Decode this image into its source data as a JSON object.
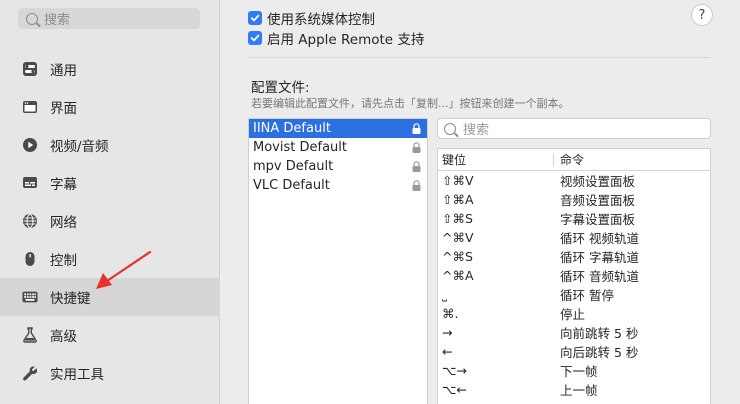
{
  "sidebar": {
    "search_placeholder": "搜索",
    "items": [
      {
        "label": "通用",
        "icon": "toggle-icon"
      },
      {
        "label": "界面",
        "icon": "window-icon"
      },
      {
        "label": "视频/音频",
        "icon": "play-icon"
      },
      {
        "label": "字幕",
        "icon": "subtitle-icon"
      },
      {
        "label": "网络",
        "icon": "globe-icon"
      },
      {
        "label": "控制",
        "icon": "mouse-icon"
      },
      {
        "label": "快捷键",
        "icon": "keyboard-icon"
      },
      {
        "label": "高级",
        "icon": "flask-icon"
      },
      {
        "label": "实用工具",
        "icon": "wrench-icon"
      }
    ],
    "active_index": 6
  },
  "options": {
    "system_media": "使用系统媒体控制",
    "apple_remote": "启用 Apple Remote 支持"
  },
  "help_label": "?",
  "config": {
    "title": "配置文件:",
    "hint": "若要编辑此配置文件，请先点击「复制...」按钮来创建一个副本。",
    "files": [
      "IINA Default",
      "Movist Default",
      "mpv Default",
      "VLC Default"
    ],
    "selected_index": 0
  },
  "keybind_search_placeholder": "搜索",
  "table": {
    "headers": {
      "key": "键位",
      "command": "命令"
    },
    "rows": [
      {
        "key": "⇧⌘V",
        "command": "视频设置面板"
      },
      {
        "key": "⇧⌘A",
        "command": "音频设置面板"
      },
      {
        "key": "⇧⌘S",
        "command": "字幕设置面板"
      },
      {
        "key": "^⌘V",
        "command": "循环 视频轨道"
      },
      {
        "key": "^⌘S",
        "command": "循环 字幕轨道"
      },
      {
        "key": "^⌘A",
        "command": "循环 音频轨道"
      },
      {
        "key": "˽",
        "command": "循环 暂停"
      },
      {
        "key": "⌘.",
        "command": "停止"
      },
      {
        "key": "→",
        "command": "向前跳转 5 秒"
      },
      {
        "key": "←",
        "command": "向后跳转 5 秒"
      },
      {
        "key": "⌥→",
        "command": "下一帧"
      },
      {
        "key": "⌥←",
        "command": "上一帧"
      }
    ]
  },
  "colors": {
    "accent": "#2f7cf6",
    "annotation_arrow": "#e8322b"
  }
}
